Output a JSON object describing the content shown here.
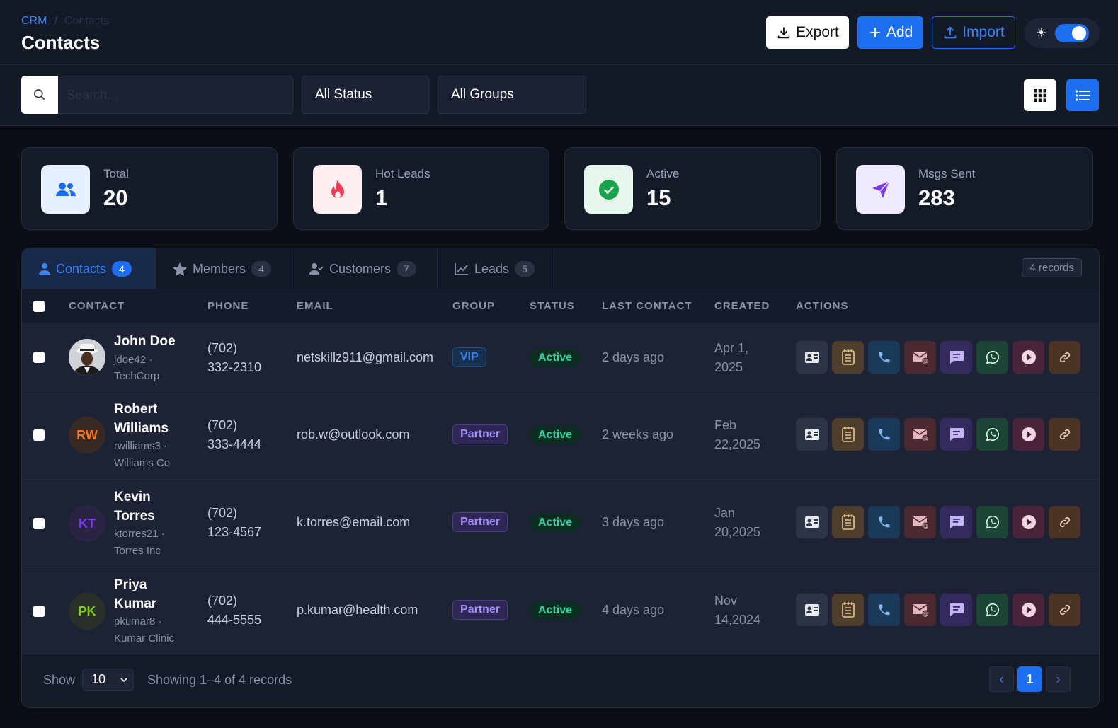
{
  "header": {
    "breadcrumb_root": "CRM",
    "breadcrumb_sep": "/",
    "breadcrumb_current": "Contacts",
    "title": "Contacts",
    "export_label": "Export",
    "add_label": "Add",
    "import_label": "Import"
  },
  "filters": {
    "search_placeholder": "Search...",
    "status": "All Status",
    "groups": "All Groups"
  },
  "stats": [
    {
      "label": "Total",
      "value": "20"
    },
    {
      "label": "Hot Leads",
      "value": "1"
    },
    {
      "label": "Active",
      "value": "15"
    },
    {
      "label": "Msgs Sent",
      "value": "283"
    }
  ],
  "tabs": [
    {
      "label": "Contacts",
      "count": "4"
    },
    {
      "label": "Members",
      "count": "4"
    },
    {
      "label": "Customers",
      "count": "7"
    },
    {
      "label": "Leads",
      "count": "5"
    }
  ],
  "records_badge": "4 records",
  "columns": [
    "CONTACT",
    "PHONE",
    "EMAIL",
    "GROUP",
    "STATUS",
    "LAST CONTACT",
    "CREATED",
    "ACTIONS"
  ],
  "rows": [
    {
      "name1": "John Doe",
      "name2": "",
      "user": "jdoe42 ·",
      "company": "TechCorp",
      "initials": "",
      "phone1": "(702)",
      "phone2": "332-2310",
      "email": "netskillz911@gmail.com",
      "group": "VIP",
      "status": "Active",
      "last": "2 days ago",
      "created1": "Apr 1,",
      "created2": "2025"
    },
    {
      "name1": "Robert",
      "name2": "Williams",
      "user": "rwilliams3 ·",
      "company": "Williams Co",
      "initials": "RW",
      "phone1": "(702)",
      "phone2": "333-4444",
      "email": "rob.w@outlook.com",
      "group": "Partner",
      "status": "Active",
      "last": "2 weeks ago",
      "created1": "Feb",
      "created2": "22,2025"
    },
    {
      "name1": "Kevin",
      "name2": "Torres",
      "user": "ktorres21 ·",
      "company": "Torres Inc",
      "initials": "KT",
      "phone1": "(702)",
      "phone2": "123-4567",
      "email": "k.torres@email.com",
      "group": "Partner",
      "status": "Active",
      "last": "3 days ago",
      "created1": "Jan",
      "created2": "20,2025"
    },
    {
      "name1": "Priya",
      "name2": "Kumar",
      "user": "pkumar8 ·",
      "company": "Kumar Clinic",
      "initials": "PK",
      "phone1": "(702)",
      "phone2": "444-5555",
      "email": "p.kumar@health.com",
      "group": "Partner",
      "status": "Active",
      "last": "4 days ago",
      "created1": "Nov",
      "created2": "14,2024"
    }
  ],
  "footer": {
    "show_label": "Show",
    "page_size": "10",
    "showing": "Showing 1–4 of 4 records",
    "prev": "‹",
    "page": "1",
    "next": "›"
  },
  "colors": {
    "accent": "#1d6ff2",
    "rw_avatar": "#f97316",
    "kt_avatar": "#7c3aed",
    "pk_avatar": "#84cc16"
  }
}
